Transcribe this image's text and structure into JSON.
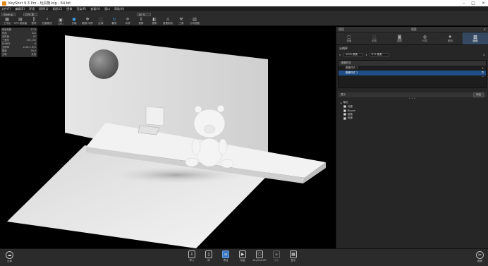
{
  "titlebar": {
    "title": "KeyShot 9.3 Pro  -  玩具熊.bip  -  64 bit"
  },
  "menu": [
    "文件(F)",
    "编辑(E)",
    "环境",
    "照明(L)",
    "相机(C)",
    "图像",
    "渲染(R)",
    "查看(V)",
    "窗口",
    "帮助(H)"
  ],
  "toolbar": {
    "workspace_select": "Startup",
    "cpu_select": "GPU 核",
    "zoom_value": "80 %",
    "items": [
      {
        "label": "工作区",
        "icon": "workspace-icon"
      },
      {
        "label": "CPU 使用量",
        "icon": "cpu-icon"
      },
      {
        "label": "暂停",
        "icon": "pause-icon"
      },
      {
        "label": "性能模式",
        "icon": "performance-icon"
      },
      {
        "label": "GPU",
        "icon": "gpu-icon"
      },
      {
        "label": "去噪",
        "icon": "denoise-icon"
      },
      {
        "label": "翻滚/平移",
        "icon": "tumble-icon"
      },
      {
        "label": "区域",
        "icon": "region-icon"
      },
      {
        "label": "翻滚",
        "icon": "rotate-icon"
      },
      {
        "label": "平移",
        "icon": "pan-icon"
      },
      {
        "label": "推移",
        "icon": "dolly-icon"
      },
      {
        "label": "视角",
        "icon": "fov-icon"
      },
      {
        "label": "重置相机",
        "icon": "reset-camera-icon"
      },
      {
        "label": "工具",
        "icon": "tools-icon"
      },
      {
        "label": "几何视图",
        "icon": "geometry-view-icon"
      }
    ]
  },
  "viewport": {
    "stats": [
      {
        "label": "每秒帧数",
        "value": "17.6"
      },
      {
        "label": "时间",
        "value": "42s"
      },
      {
        "label": "采样值",
        "value": "97"
      },
      {
        "label": "三角形",
        "value": "192,152"
      },
      {
        "label": "NURBS",
        "value": "0"
      },
      {
        "label": "分辨率",
        "value": "1200 x 675"
      },
      {
        "label": "焦距",
        "value": "50.0"
      },
      {
        "label": "去噪",
        "value": "关闭"
      }
    ]
  },
  "panel": {
    "header_left": "项目",
    "header_center": "项目",
    "tabs": [
      "场景",
      "材质",
      "相机",
      "环境",
      "照明",
      "图像"
    ],
    "active_tab": 5,
    "section_title": "分辨率",
    "res_width": "1200 像素",
    "res_height": "675 像素",
    "studio_list_title": "图像样式",
    "studio_items": [
      "图像样式 1",
      "图像样式 2"
    ],
    "layer_header": "显示",
    "layer_button": "添加",
    "tree": [
      {
        "label": "曝光",
        "indent": false
      },
      {
        "label": "光晕",
        "indent": true
      },
      {
        "label": "Bloom",
        "indent": true
      },
      {
        "label": "暗角",
        "indent": true
      },
      {
        "label": "色差",
        "indent": true
      }
    ]
  },
  "bottombar": {
    "left_label": "云库",
    "right_label": "截屏",
    "items": [
      {
        "label": "导入",
        "icon": "import-icon",
        "state": ""
      },
      {
        "label": "库",
        "icon": "library-icon",
        "state": ""
      },
      {
        "label": "项目",
        "icon": "project-icon",
        "state": "active"
      },
      {
        "label": "动画",
        "icon": "animation-icon",
        "state": ""
      },
      {
        "label": "KeyShotXR",
        "icon": "keyshotxr-icon",
        "state": ""
      },
      {
        "label": "渲染",
        "icon": "render-icon",
        "state": "disabled"
      },
      {
        "label": "显示",
        "icon": "display-icon",
        "state": ""
      }
    ]
  }
}
